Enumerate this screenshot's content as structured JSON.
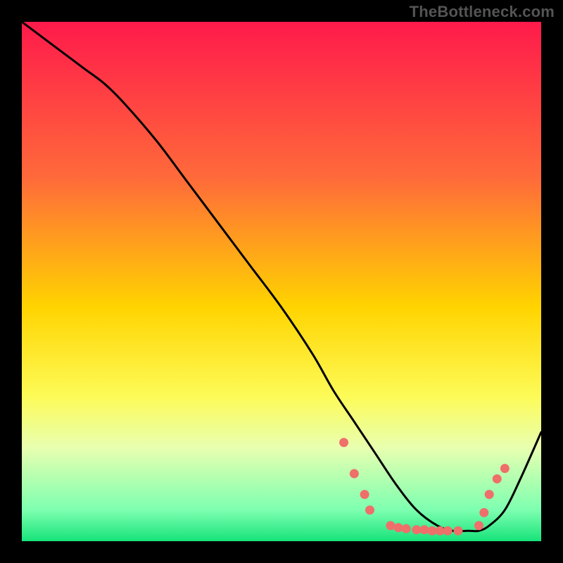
{
  "watermark": "TheBottleneck.com",
  "chart_data": {
    "type": "line",
    "title": "",
    "xlabel": "",
    "ylabel": "",
    "xlim": [
      0,
      100
    ],
    "ylim": [
      0,
      100
    ],
    "grid": false,
    "legend": false,
    "gradient_stops": [
      {
        "offset": 0,
        "color": "#ff1a4b"
      },
      {
        "offset": 0.3,
        "color": "#ff6a3a"
      },
      {
        "offset": 0.55,
        "color": "#ffd400"
      },
      {
        "offset": 0.72,
        "color": "#fdfb57"
      },
      {
        "offset": 0.82,
        "color": "#e8ffb0"
      },
      {
        "offset": 0.94,
        "color": "#7dffb0"
      },
      {
        "offset": 1.0,
        "color": "#16e37a"
      }
    ],
    "series": [
      {
        "name": "curve",
        "color": "#000000",
        "x": [
          0,
          4,
          8,
          12,
          16,
          20,
          26,
          32,
          38,
          44,
          50,
          56,
          60,
          64,
          68,
          72,
          76,
          80,
          83,
          86,
          88,
          90,
          93,
          96,
          100
        ],
        "y": [
          100,
          97,
          94,
          91,
          88,
          84,
          77,
          69,
          61,
          53,
          45,
          36,
          29,
          23,
          17,
          11,
          6,
          3,
          2,
          2,
          2,
          3,
          6,
          12,
          21
        ]
      }
    ],
    "markers": {
      "name": "dots",
      "color": "#ef6f6a",
      "radius": 6.5,
      "points": [
        {
          "x": 62,
          "y": 19
        },
        {
          "x": 64,
          "y": 13
        },
        {
          "x": 66,
          "y": 9
        },
        {
          "x": 67,
          "y": 6
        },
        {
          "x": 71,
          "y": 3
        },
        {
          "x": 72.5,
          "y": 2.6
        },
        {
          "x": 74,
          "y": 2.4
        },
        {
          "x": 76,
          "y": 2.2
        },
        {
          "x": 77.5,
          "y": 2.2
        },
        {
          "x": 79,
          "y": 2
        },
        {
          "x": 80.5,
          "y": 2
        },
        {
          "x": 82,
          "y": 2
        },
        {
          "x": 84,
          "y": 2
        },
        {
          "x": 88,
          "y": 3
        },
        {
          "x": 89,
          "y": 5.5
        },
        {
          "x": 90,
          "y": 9
        },
        {
          "x": 91.5,
          "y": 12
        },
        {
          "x": 93,
          "y": 14
        }
      ]
    }
  }
}
